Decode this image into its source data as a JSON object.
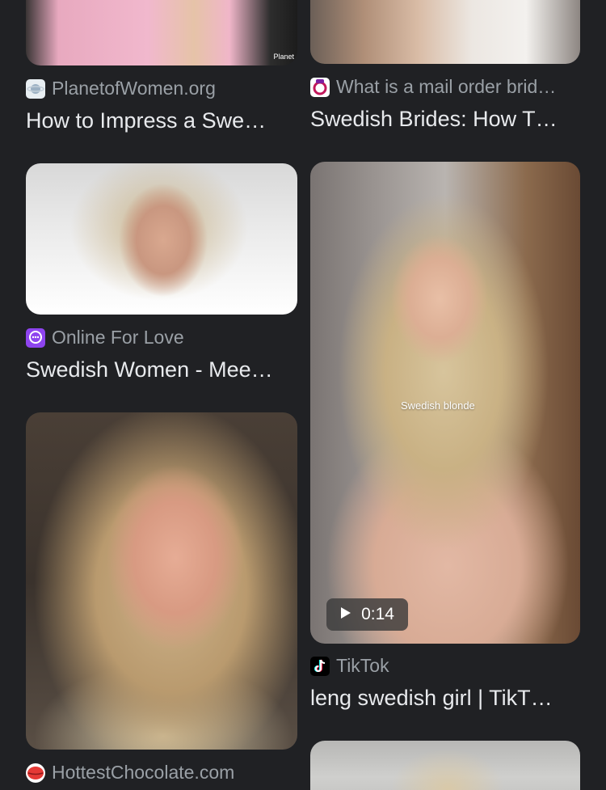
{
  "colors": {
    "background": "#202124",
    "source_text": "#9aa0a6",
    "title_text": "#e8eaed"
  },
  "results": [
    {
      "source": "PlanetofWomen.org",
      "title": "How to Impress a Swe…",
      "favicon": "planet-of-women-favicon",
      "watermark": "Planet"
    },
    {
      "source": "What is a mail order brid…",
      "title": "Swedish Brides: How T…",
      "favicon": "mail-order-bride-favicon"
    },
    {
      "source": "Online For Love",
      "title": "Swedish Women - Mee…",
      "favicon": "online-for-love-favicon"
    },
    {
      "source": "TikTok",
      "title": "leng swedish girl | TikT…",
      "favicon": "tiktok-favicon",
      "duration": "0:14",
      "overlay_caption": "Swedish blonde"
    },
    {
      "source": "HottestChocolate.com",
      "title": "",
      "favicon": "hottest-chocolate-favicon"
    }
  ]
}
